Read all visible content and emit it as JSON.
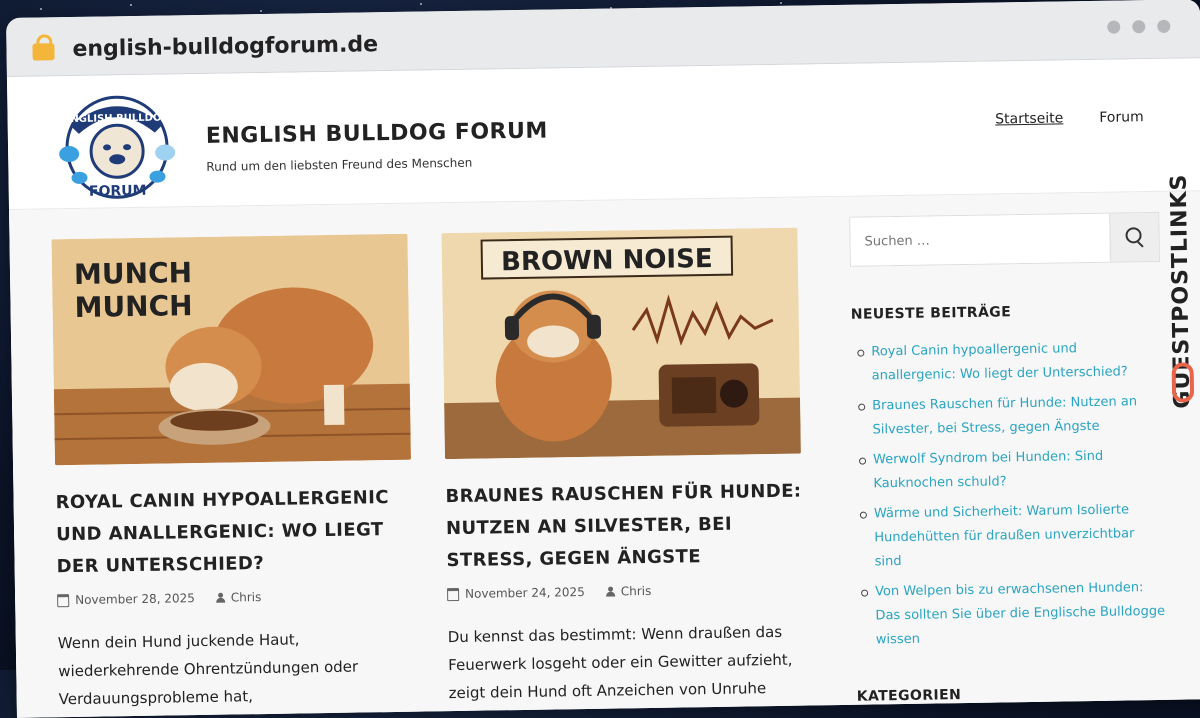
{
  "browser": {
    "url": "english-bulldogforum.de"
  },
  "site": {
    "title": "ENGLISH BULLDOG FORUM",
    "tagline": "Rund um den liebsten Freund des Menschen",
    "logo_top_text": "ENGLISH BULLDOG",
    "logo_bottom_text": "FORUM"
  },
  "nav": {
    "items": [
      {
        "label": "Startseite"
      },
      {
        "label": "Forum"
      }
    ]
  },
  "posts": [
    {
      "thumb_text_1": "MUNCH",
      "thumb_text_2": "MUNCH",
      "title": "ROYAL CANIN HYPOALLERGENIC UND ANALLERGENIC: WO LIEGT DER UNTERSCHIED?",
      "date": "November 28, 2025",
      "author": "Chris",
      "excerpt": "Wenn dein Hund juckende Haut, wiederkehrende Ohrentzündungen oder Verdauungsprobleme hat,"
    },
    {
      "thumb_text_1": "BROWN NOISE",
      "title": "BRAUNES RAUSCHEN FÜR HUNDE: NUTZEN AN SILVESTER, BEI STRESS, GEGEN ÄNGSTE",
      "date": "November 24, 2025",
      "author": "Chris",
      "excerpt": "Du kennst das bestimmt: Wenn draußen das Feuerwerk losgeht oder ein Gewitter aufzieht, zeigt dein Hund oft Anzeichen von Unruhe"
    }
  ],
  "sidebar": {
    "search_placeholder": "Suchen …",
    "recent_title": "NEUESTE BEITRÄGE",
    "recent": [
      {
        "label": "Royal Canin hypoallergenic und anallergenic: Wo liegt der Unterschied?"
      },
      {
        "label": "Braunes Rauschen für Hunde: Nutzen an Silvester, bei Stress, gegen Ängste"
      },
      {
        "label": "Werwolf Syndrom bei Hunden: Sind Kauknochen schuld?"
      },
      {
        "label": "Wärme und Sicherheit: Warum Isolierte Hundehütten für draußen unverzichtbar sind"
      },
      {
        "label": "Von Welpen bis zu erwachsenen Hunden: Das sollten Sie über die Englische Bulldogge wissen"
      }
    ],
    "categories_title": "KATEGORIEN"
  },
  "watermark": {
    "text": "GUESTPOSTLINKS"
  },
  "colors": {
    "link": "#2aa4c2",
    "brand_accent": "#e8654a"
  }
}
